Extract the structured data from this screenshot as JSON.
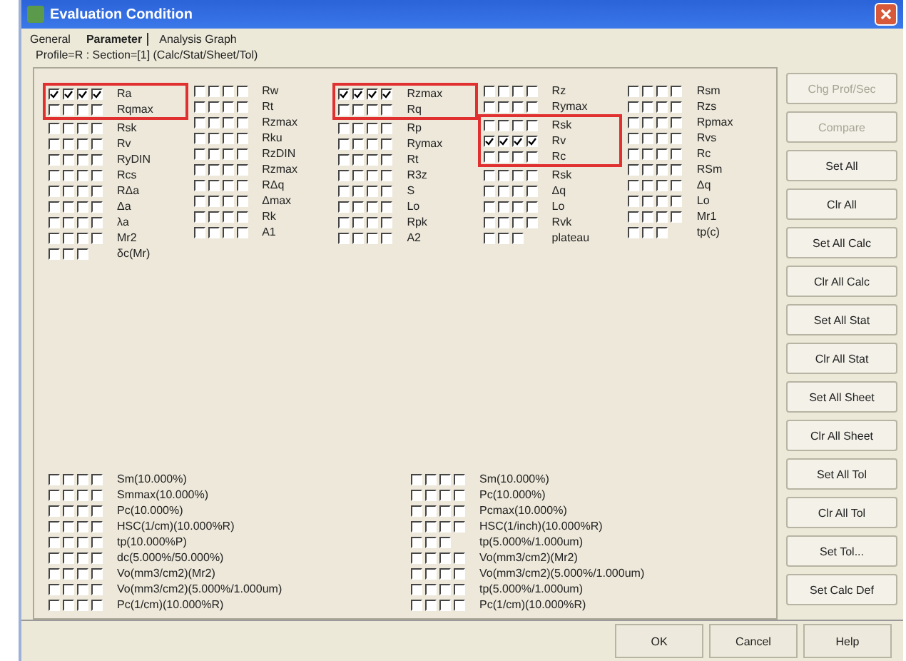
{
  "window": {
    "title": "Evaluation Condition"
  },
  "tabs": [
    {
      "label": "General",
      "selected": false
    },
    {
      "label": "Parameter",
      "selected": true
    },
    {
      "label": "Analysis Graph",
      "selected": false
    }
  ],
  "profile_line": "Profile=R : Section=[1] (Calc/Stat/Sheet/Tol)",
  "parameter_columns": [
    [
      {
        "label": "Ra",
        "checks": [
          true,
          true,
          true,
          true
        ],
        "highlight": true
      },
      {
        "label": "Rqmax",
        "checks": [
          false,
          false,
          false,
          false
        ],
        "highlight": true
      },
      {
        "label": "Rsk",
        "checks": [
          false,
          false,
          false,
          false
        ],
        "highlight": false
      },
      {
        "label": "Rv",
        "checks": [
          false,
          false,
          false,
          false
        ],
        "highlight": false
      },
      {
        "label": "RyDIN",
        "checks": [
          false,
          false,
          false,
          false
        ],
        "highlight": false
      },
      {
        "label": "Rcs",
        "checks": [
          false,
          false,
          false,
          false
        ],
        "highlight": false
      },
      {
        "label": "RΔa",
        "checks": [
          false,
          false,
          false,
          false
        ],
        "highlight": false
      },
      {
        "label": "Δa",
        "checks": [
          false,
          false,
          false,
          false
        ],
        "highlight": false
      },
      {
        "label": "λa",
        "checks": [
          false,
          false,
          false,
          false
        ],
        "highlight": false
      },
      {
        "label": "Mr2",
        "checks": [
          false,
          false,
          false,
          false
        ],
        "highlight": false
      },
      {
        "label": "δc(Mr)",
        "checks": [
          false,
          false,
          false
        ],
        "highlight": false
      }
    ],
    [
      {
        "label": "Rw",
        "checks": [
          false,
          false,
          false,
          false
        ],
        "highlight": false
      },
      {
        "label": "Rt",
        "checks": [
          false,
          false,
          false,
          false
        ],
        "highlight": false
      },
      {
        "label": "Rzmax",
        "checks": [
          false,
          false,
          false,
          false
        ],
        "highlight": false
      },
      {
        "label": "Rku",
        "checks": [
          false,
          false,
          false,
          false
        ],
        "highlight": false
      },
      {
        "label": "RzDIN",
        "checks": [
          false,
          false,
          false,
          false
        ],
        "highlight": false
      },
      {
        "label": "Rzmax",
        "checks": [
          false,
          false,
          false,
          false
        ],
        "highlight": false
      },
      {
        "label": "RΔq",
        "checks": [
          false,
          false,
          false,
          false
        ],
        "highlight": false
      },
      {
        "label": "Δmax",
        "checks": [
          false,
          false,
          false,
          false
        ],
        "highlight": false
      },
      {
        "label": "Rk",
        "checks": [
          false,
          false,
          false,
          false
        ],
        "highlight": false
      },
      {
        "label": "A1",
        "checks": [
          false,
          false,
          false,
          false
        ],
        "highlight": false
      }
    ],
    [
      {
        "label": "Rzmax",
        "checks": [
          true,
          true,
          true,
          true
        ],
        "highlight": true
      },
      {
        "label": "Rq",
        "checks": [
          false,
          false,
          false,
          false
        ],
        "highlight": true
      },
      {
        "label": "Rp",
        "checks": [
          false,
          false,
          false,
          false
        ],
        "highlight": false
      },
      {
        "label": "Rymax",
        "checks": [
          false,
          false,
          false,
          false
        ],
        "highlight": false
      },
      {
        "label": "Rt",
        "checks": [
          false,
          false,
          false,
          false
        ],
        "highlight": false
      },
      {
        "label": "R3z",
        "checks": [
          false,
          false,
          false,
          false
        ],
        "highlight": false
      },
      {
        "label": "S",
        "checks": [
          false,
          false,
          false,
          false
        ],
        "highlight": false
      },
      {
        "label": "Lo",
        "checks": [
          false,
          false,
          false,
          false
        ],
        "highlight": false
      },
      {
        "label": "Rpk",
        "checks": [
          false,
          false,
          false,
          false
        ],
        "highlight": false
      },
      {
        "label": "A2",
        "checks": [
          false,
          false,
          false,
          false
        ],
        "highlight": false
      }
    ],
    [
      {
        "label": "Rz",
        "checks": [
          false,
          false,
          false,
          false
        ],
        "highlight": false
      },
      {
        "label": "Rymax",
        "checks": [
          false,
          false,
          false,
          false
        ],
        "highlight": false
      },
      {
        "label": "Rsk",
        "checks": [
          false,
          false,
          false,
          false
        ],
        "highlight": true
      },
      {
        "label": "Rv",
        "checks": [
          true,
          true,
          true,
          true
        ],
        "highlight": true
      },
      {
        "label": "Rc",
        "checks": [
          false,
          false,
          false,
          false
        ],
        "highlight": true
      },
      {
        "label": "Rsk",
        "checks": [
          false,
          false,
          false,
          false
        ],
        "highlight": false
      },
      {
        "label": "Δq",
        "checks": [
          false,
          false,
          false,
          false
        ],
        "highlight": false
      },
      {
        "label": "Lo",
        "checks": [
          false,
          false,
          false,
          false
        ],
        "highlight": false
      },
      {
        "label": "Rvk",
        "checks": [
          false,
          false,
          false,
          false
        ],
        "highlight": false
      },
      {
        "label": "plateau",
        "checks": [
          false,
          false,
          false
        ],
        "highlight": false
      }
    ],
    [
      {
        "label": "Rsm",
        "checks": [
          false,
          false,
          false,
          false
        ],
        "highlight": false
      },
      {
        "label": "Rzs",
        "checks": [
          false,
          false,
          false,
          false
        ],
        "highlight": false
      },
      {
        "label": "Rpmax",
        "checks": [
          false,
          false,
          false,
          false
        ],
        "highlight": false
      },
      {
        "label": "Rvs",
        "checks": [
          false,
          false,
          false,
          false
        ],
        "highlight": false
      },
      {
        "label": "Rc",
        "checks": [
          false,
          false,
          false,
          false
        ],
        "highlight": false
      },
      {
        "label": "RSm",
        "checks": [
          false,
          false,
          false,
          false
        ],
        "highlight": false
      },
      {
        "label": "Δq",
        "checks": [
          false,
          false,
          false,
          false
        ],
        "highlight": false
      },
      {
        "label": "Lo",
        "checks": [
          false,
          false,
          false,
          false
        ],
        "highlight": false
      },
      {
        "label": "Mr1",
        "checks": [
          false,
          false,
          false,
          false
        ],
        "highlight": false
      },
      {
        "label": "tp(c)",
        "checks": [
          false,
          false,
          false
        ],
        "highlight": false
      }
    ]
  ],
  "ratio_columns": [
    [
      {
        "label": "Sm(10.000%)",
        "checks": [
          false,
          false,
          false,
          false
        ]
      },
      {
        "label": "Smmax(10.000%)",
        "checks": [
          false,
          false,
          false,
          false
        ]
      },
      {
        "label": "Pc(10.000%)",
        "checks": [
          false,
          false,
          false,
          false
        ]
      },
      {
        "label": "HSC(1/cm)(10.000%R)",
        "checks": [
          false,
          false,
          false,
          false
        ]
      },
      {
        "label": "tp(10.000%P)",
        "checks": [
          false,
          false,
          false,
          false
        ]
      },
      {
        "label": "dc(5.000%/50.000%)",
        "checks": [
          false,
          false,
          false,
          false
        ]
      },
      {
        "label": "Vo(mm3/cm2)(Mr2)",
        "checks": [
          false,
          false,
          false,
          false
        ]
      },
      {
        "label": "Vo(mm3/cm2)(5.000%/1.000um)",
        "checks": [
          false,
          false,
          false,
          false
        ]
      },
      {
        "label": "Pc(1/cm)(10.000%R)",
        "checks": [
          false,
          false,
          false,
          false
        ]
      }
    ],
    [
      {
        "label": "Sm(10.000%)",
        "checks": [
          false,
          false,
          false,
          false
        ]
      },
      {
        "label": "Pc(10.000%)",
        "checks": [
          false,
          false,
          false,
          false
        ]
      },
      {
        "label": "Pcmax(10.000%)",
        "checks": [
          false,
          false,
          false,
          false
        ]
      },
      {
        "label": "HSC(1/inch)(10.000%R)",
        "checks": [
          false,
          false,
          false,
          false
        ]
      },
      {
        "label": "tp(5.000%/1.000um)",
        "checks": [
          false,
          false,
          false
        ]
      },
      {
        "label": "Vo(mm3/cm2)(Mr2)",
        "checks": [
          false,
          false,
          false,
          false
        ]
      },
      {
        "label": "Vo(mm3/cm2)(5.000%/1.000um)",
        "checks": [
          false,
          false,
          false,
          false
        ]
      },
      {
        "label": "tp(5.000%/1.000um)",
        "checks": [
          false,
          false,
          false,
          false
        ]
      },
      {
        "label": "Pc(1/cm)(10.000%R)",
        "checks": [
          false,
          false,
          false,
          false
        ]
      }
    ]
  ],
  "side_buttons": [
    {
      "label": "Chg Prof/Sec",
      "disabled": true
    },
    {
      "label": "Compare",
      "disabled": true
    },
    {
      "label": "Set All",
      "disabled": false
    },
    {
      "label": "Clr All",
      "disabled": false
    },
    {
      "label": "Set All Calc",
      "disabled": false
    },
    {
      "label": "Clr All Calc",
      "disabled": false
    },
    {
      "label": "Set All Stat",
      "disabled": false
    },
    {
      "label": "Clr All Stat",
      "disabled": false
    },
    {
      "label": "Set All Sheet",
      "disabled": false
    },
    {
      "label": "Clr All Sheet",
      "disabled": false
    },
    {
      "label": "Set All Tol",
      "disabled": false
    },
    {
      "label": "Clr All Tol",
      "disabled": false
    },
    {
      "label": "Set Tol...",
      "disabled": false
    },
    {
      "label": "Set Calc Def",
      "disabled": false
    }
  ],
  "footer_buttons": [
    "OK",
    "Cancel",
    "Help"
  ]
}
